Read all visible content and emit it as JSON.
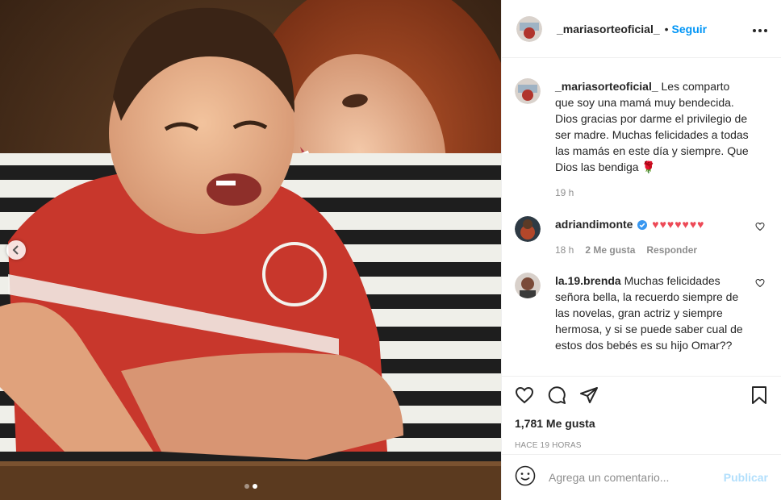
{
  "post": {
    "username": "_mariasorteoficial_",
    "follow_label": "Seguir",
    "separator": "•",
    "more_icon": "more-horizontal-icon"
  },
  "caption": {
    "username": "_mariasorteoficial_",
    "text": "Les comparto que soy una mamá muy bendecida. Dios gracias por darme el privilegio de ser madre. Muchas felicidades a todas las mamás en este día y siempre. Que Dios las bendiga 🌹",
    "time": "19 h"
  },
  "comments": [
    {
      "username": "adriandimonte",
      "verified": true,
      "text": "♥♥♥♥♥♥♥",
      "time": "18 h",
      "likes": "2 Me gusta",
      "reply_label": "Responder"
    },
    {
      "username": "la.19.brenda",
      "verified": false,
      "text": "Muchas felicidades señora bella, la recuerdo siempre de las novelas, gran actriz y siempre hermosa, y si se puede saber cual de estos dos bebés es su hijo Omar??"
    }
  ],
  "actions": {
    "likes_count": "1,781 Me gusta",
    "timestamp": "HACE 19 HORAS"
  },
  "add_comment": {
    "placeholder": "Agrega un comentario...",
    "publish_label": "Publicar"
  },
  "carousel": {
    "current": 2,
    "total": 2
  },
  "colors": {
    "link": "#0095f6",
    "publish_disabled": "#b2dffc",
    "heart_red": "#ed4956",
    "secondary_text": "#8e8e8e"
  }
}
